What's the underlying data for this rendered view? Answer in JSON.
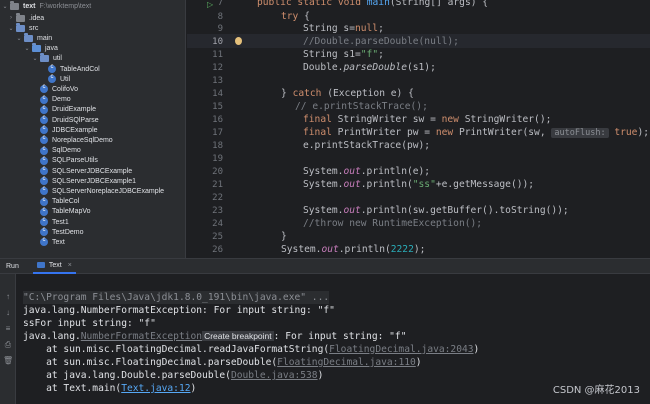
{
  "tree": {
    "root": {
      "label": "text",
      "path": "F:\\worktemp\\text"
    },
    "items": [
      {
        "label": ".idea",
        "depth": 1,
        "kind": "folder-gray",
        "chev": "›"
      },
      {
        "label": "src",
        "depth": 1,
        "kind": "folder",
        "chev": "⌄"
      },
      {
        "label": "main",
        "depth": 2,
        "kind": "folder",
        "chev": "⌄"
      },
      {
        "label": "java",
        "depth": 3,
        "kind": "folder-src",
        "chev": "⌄"
      },
      {
        "label": "util",
        "depth": 4,
        "kind": "folder",
        "chev": "⌄"
      },
      {
        "label": "TableAndCol",
        "depth": 5,
        "kind": "class"
      },
      {
        "label": "Util",
        "depth": 5,
        "kind": "class"
      },
      {
        "label": "ColifoVo",
        "depth": 4,
        "kind": "class"
      },
      {
        "label": "Demo",
        "depth": 4,
        "kind": "class"
      },
      {
        "label": "DruidExample",
        "depth": 4,
        "kind": "class"
      },
      {
        "label": "DruidSQlParse",
        "depth": 4,
        "kind": "class"
      },
      {
        "label": "JDBCExample",
        "depth": 4,
        "kind": "class"
      },
      {
        "label": "NoreplaceSqlDemo",
        "depth": 4,
        "kind": "class"
      },
      {
        "label": "SqlDemo",
        "depth": 4,
        "kind": "class"
      },
      {
        "label": "SQLParseUtils",
        "depth": 4,
        "kind": "class"
      },
      {
        "label": "SQLServerJDBCExample",
        "depth": 4,
        "kind": "class"
      },
      {
        "label": "SQLServerJDBCExample1",
        "depth": 4,
        "kind": "class"
      },
      {
        "label": "SQLServerNoreplaceJDBCExample",
        "depth": 4,
        "kind": "class"
      },
      {
        "label": "TableCol",
        "depth": 4,
        "kind": "class"
      },
      {
        "label": "TableMapVo",
        "depth": 4,
        "kind": "class"
      },
      {
        "label": "Test1",
        "depth": 4,
        "kind": "class"
      },
      {
        "label": "TestDemo",
        "depth": 4,
        "kind": "class"
      },
      {
        "label": "Text",
        "depth": 4,
        "kind": "class"
      }
    ]
  },
  "editor": {
    "line_numbers": [
      "7",
      "8",
      "9",
      "10",
      "11",
      "12",
      "13",
      "14",
      "15",
      "16",
      "17",
      "18",
      "19",
      "20",
      "21",
      "22",
      "23",
      "24",
      "25",
      "26"
    ],
    "current_line": "10"
  },
  "run": {
    "label": "Run",
    "tab": "Text",
    "close": "×"
  },
  "console": {
    "cmd": "\"C:\\Program Files\\Java\\jdk1.8.0_191\\bin\\java.exe\" ...",
    "line1": "java.lang.NumberFormatException: For input string: \"f\"",
    "line2": "ssFor input string: \"f\"",
    "line3_a": "java.lang.",
    "line3_b": "NumberFormatException",
    "line3_bp": "Create breakpoint",
    "line3_c": ": For input string: \"f\"",
    "line4_a": "    at sun.misc.FloatingDecimal.readJavaFormatString(",
    "line4_link": "FloatingDecimal.java:2043",
    "line4_c": ")",
    "line5_a": "    at sun.misc.FloatingDecimal.parseDouble(",
    "line5_link": "FloatingDecimal.java:110",
    "line5_c": ")",
    "line6_a": "    at java.lang.Double.parseDouble(",
    "line6_link": "Double.java:538",
    "line6_c": ")",
    "line7_a": "    at Text.main(",
    "line7_link": "Text.java:12",
    "line7_c": ")"
  },
  "watermark": "CSDN @麻花2013",
  "colors": {
    "background": "#1e1f22",
    "panel": "#2b2d30",
    "keyword": "#cf8e6d",
    "string": "#6aab73",
    "link": "#56a8f5"
  }
}
